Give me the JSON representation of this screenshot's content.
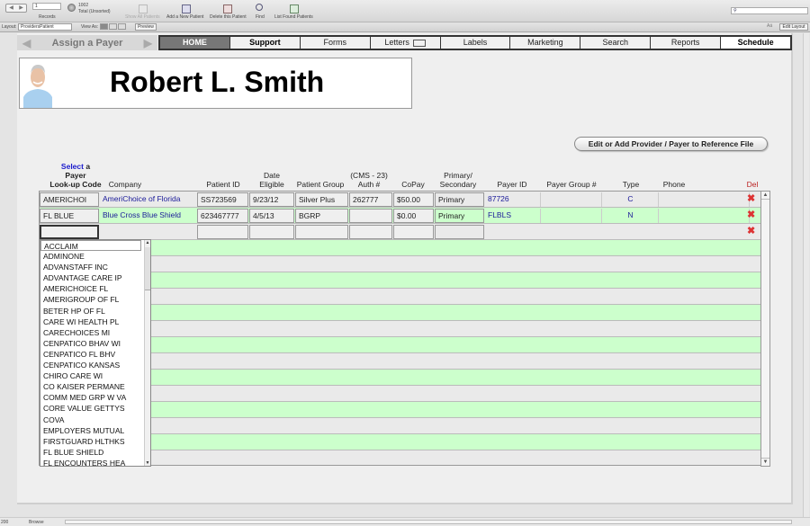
{
  "toolbar": {
    "record_number": "1",
    "records_label": "Records",
    "total_count": "1002",
    "total_label": "Total (Unsorted)",
    "show_all_label": "Show All Patients",
    "add_label": "Add a New Patient",
    "delete_label": "Delete this Patient",
    "find_label": "Find",
    "list_found_label": "List Found Patients",
    "search_placeholder": ""
  },
  "layoutbar": {
    "layout_label": "Layout:",
    "layout_value": "ProvidersPatient",
    "view_as_label": "View As:",
    "preview_label": "Preview",
    "aa_label": "Aä",
    "edit_layout_label": "Edit Layout"
  },
  "nav": {
    "assign_title": "Assign a Payer",
    "tabs": [
      "HOME",
      "Support",
      "Forms",
      "Letters",
      "Labels",
      "Marketing",
      "Search",
      "Reports",
      "Schedule"
    ]
  },
  "patient": {
    "name": "Robert L. Smith"
  },
  "ref_button_label": "Edit or Add Provider / Payer to Reference File",
  "headers": {
    "select_word": "Select",
    "select_rest": "a",
    "payer": "Payer",
    "lookup": "Look-up Code",
    "company": "Company",
    "patient_id": "Patient ID",
    "date1": "Date",
    "date2": "Eligible",
    "patient_group": "Patient Group",
    "auth1": "(CMS - 23)",
    "auth2": "Auth #",
    "copay": "CoPay",
    "prim1": "Primary/",
    "prim2": "Secondary",
    "payer_id": "Payer ID",
    "payer_group": "Payer Group #",
    "type": "Type",
    "phone": "Phone",
    "del": "Del"
  },
  "rows": [
    {
      "code": "AMERICHOI",
      "company": "AmeriChoice of Florida",
      "patient_id": "SS723569",
      "date": "9/23/12",
      "group": "Silver Plus",
      "auth": "262777",
      "copay": "$50.00",
      "primary": "Primary",
      "payer_id": "87726",
      "payer_group": "",
      "type": "C",
      "phone": ""
    },
    {
      "code": "FL BLUE",
      "company": "Blue Cross Blue Shield",
      "patient_id": "623467777",
      "date": "4/5/13",
      "group": "BGRP",
      "auth": "",
      "copay": "$0.00",
      "primary": "Primary",
      "payer_id": "FLBLS",
      "payer_group": "",
      "type": "N",
      "phone": ""
    }
  ],
  "dropdown_options": [
    "ACCLAIM",
    "ADMINONE",
    "ADVANSTAFF INC",
    "ADVANTAGE CARE IP",
    "AMERICHOICE FL",
    "AMERIGROUP OF FL",
    "BETER HP OF FL",
    "CARE WI HEALTH PL",
    "CARECHOICES MI",
    "CENPATICO BHAV WI",
    "CENPATICO FL BHV",
    "CENPATICO KANSAS",
    "CHIRO CARE WI",
    "CO KAISER PERMANE",
    "COMM MED GRP W VA",
    "CORE VALUE GETTYS",
    "COVA",
    "EMPLOYERS MUTUAL",
    "FIRSTGUARD HLTHKS",
    "FL BLUE SHIELD",
    "FL ENCOUNTERS HEA"
  ],
  "status": {
    "zoom": "200",
    "mode": "Browse"
  },
  "colors": {
    "green_row": "#ccffcc",
    "active_tab": "#777777",
    "delete_x": "#dd3333",
    "link_blue": "#1a1a99"
  }
}
